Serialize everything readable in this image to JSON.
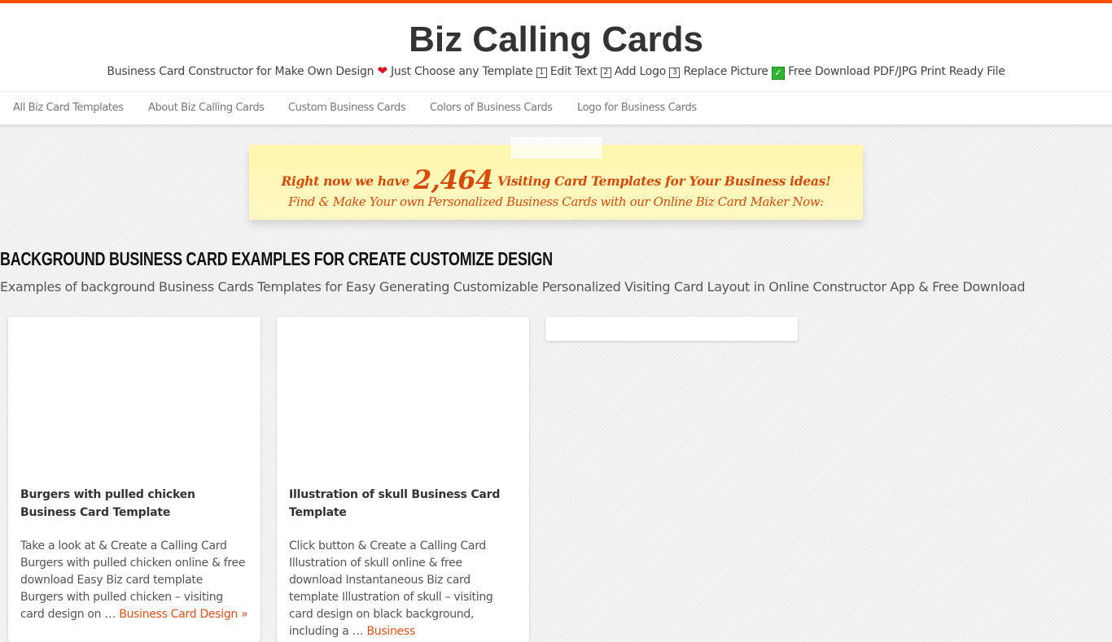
{
  "colors": {
    "accent": "#ff4e00",
    "link": "#e5501a",
    "banner_text": "#d84a0c",
    "banner_bg": "#fff6ad"
  },
  "header": {
    "site_title": "Biz Calling Cards",
    "tagline": {
      "part1": "Business Card Constructor for Make Own Design",
      "heart_icon": "❤",
      "part2": "Just Choose any Template",
      "key1": "1",
      "part3": "Edit Text",
      "key2": "2",
      "part4": "Add Logo",
      "key3": "3",
      "part5": "Replace Picture",
      "check_icon": "✓",
      "part6": "Free Download PDF/JPG Print Ready File"
    }
  },
  "nav": {
    "items": [
      {
        "label": "All Biz Card Templates"
      },
      {
        "label": "About Biz Calling Cards"
      },
      {
        "label": "Custom Business Cards"
      },
      {
        "label": "Colors of Business Cards"
      },
      {
        "label": "Logo for Business Cards"
      }
    ]
  },
  "banner": {
    "line1_prefix": "Right now we have",
    "count": "2,464",
    "line1_suffix": "Visiting Card Templates for Your Business ideas!",
    "line2": "Find & Make Your own Personalized Business Cards with our Online Biz Card Maker Now:"
  },
  "section": {
    "title": "Background Business Card Examples for Create Customize Design",
    "description": "Examples of background Business Cards Templates for Easy Generating Customizable Personalized Visiting Card Layout in Online Constructor App & Free Download"
  },
  "cards": [
    {
      "title": "Burgers with pulled chicken Business Card Template",
      "excerpt": "Take a look at & Create a Calling Card Burgers with pulled chicken online & free download Easy Biz card template Burgers with pulled chicken – visiting card design on … ",
      "link": "Business Card Design »"
    },
    {
      "title": "Illustration of skull Business Card Template",
      "excerpt": "Click button & Create a Calling Card Illustration of skull online & free download Instantaneous Biz card template Illustration of skull – visiting card design on black background, including a … ",
      "link": "Business"
    }
  ]
}
